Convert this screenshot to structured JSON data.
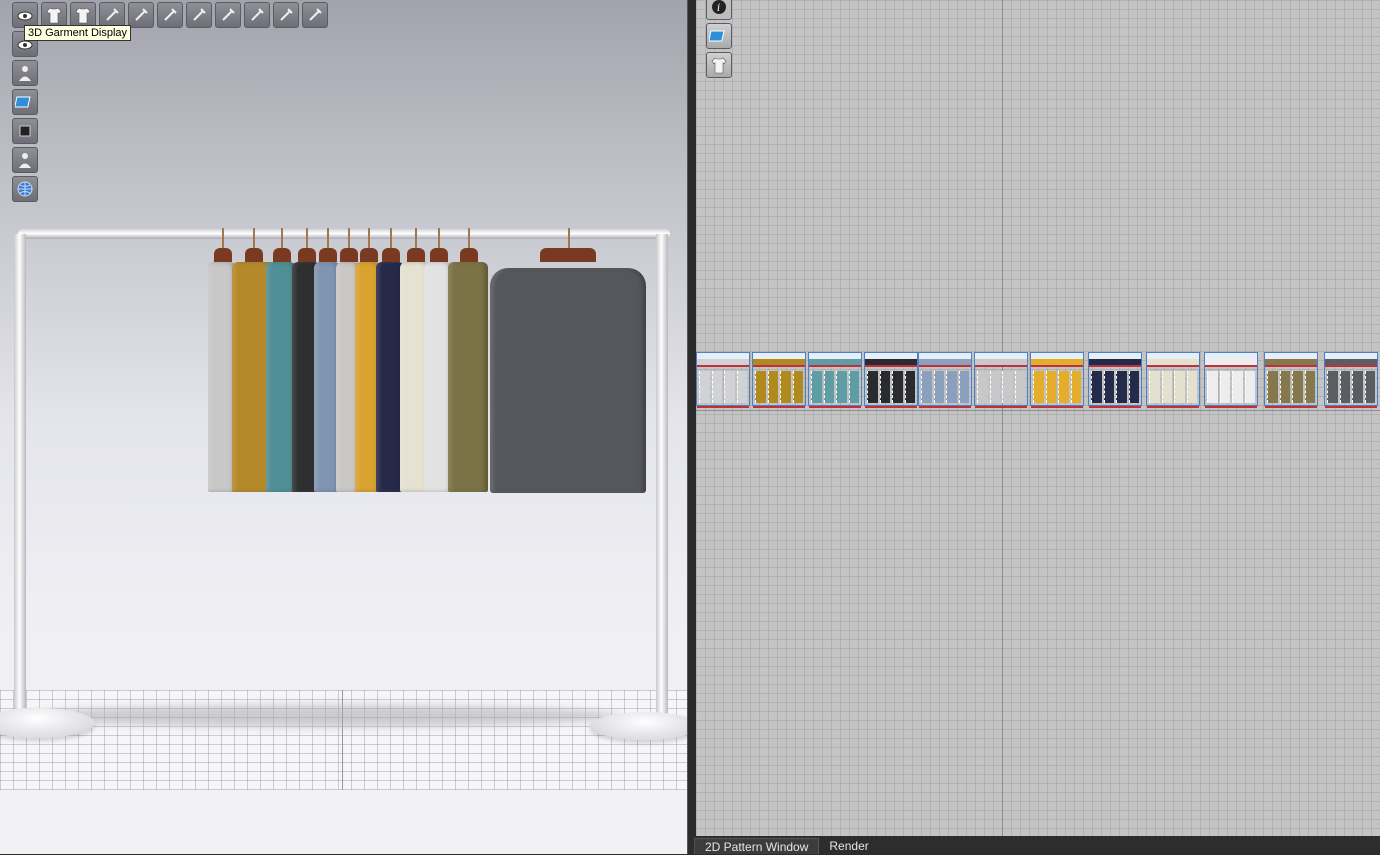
{
  "tooltip": {
    "text": "3D Garment Display"
  },
  "toolbar_3d": {
    "top_row_icons": [
      "eye-avatar-icon",
      "garment-display-icon",
      "garment-texture-icon",
      "garment-fit-icon",
      "stress-map-icon",
      "strain-map-icon",
      "fit-map-icon",
      "pin-icon",
      "measure-icon",
      "pressure-icon",
      "ruler-icon"
    ],
    "side_icons": [
      "show-avatar-icon",
      "avatar-display-icon",
      "material-display-icon",
      "render-icon",
      "avatar-silhouette-icon",
      "environment-globe-icon"
    ]
  },
  "toolbar_2d": {
    "icons": [
      "info-icon",
      "texture-icon",
      "fabric-icon"
    ]
  },
  "garments": {
    "colors": [
      "#c8c8c8",
      "#b5892a",
      "#4f8f95",
      "#2e2f31",
      "#7f95b2",
      "#c9c8c6",
      "#d9a22f",
      "#26294a",
      "#e6e2d2",
      "#e2e2e2",
      "#7b7345",
      "#55575c"
    ]
  },
  "patterns": {
    "colors": [
      "#d0d2d6",
      "#b08a1e",
      "#5f9da4",
      "#2a2b2e",
      "#8aa0bc",
      "#c8c8ca",
      "#e4ae2c",
      "#232a4a",
      "#e4e0cf",
      "#ededed",
      "#85784c",
      "#5a5d62"
    ]
  },
  "tabs": [
    {
      "label": "2D Pattern Window",
      "active": true
    },
    {
      "label": "Render",
      "active": false
    }
  ]
}
